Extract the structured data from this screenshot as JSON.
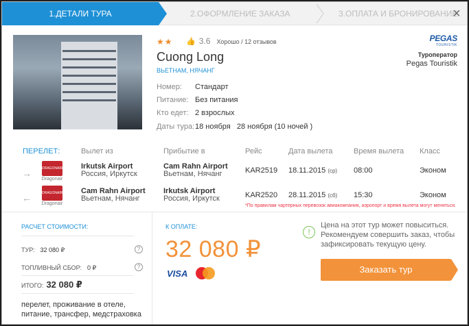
{
  "steps": [
    {
      "label": "1.Детали тура"
    },
    {
      "label": "2.Оформление заказа"
    },
    {
      "label": "3.Оплата и бронирование"
    }
  ],
  "close_glyph": "×",
  "hotel": {
    "stars": "★★",
    "rating_score": "3.6",
    "rating_text": "Хорошо / 12 отзывов",
    "name": "Cuong Long",
    "location": "Вьетнам, Нячанг",
    "details": [
      {
        "label": "Номер:",
        "value": "Стандарт"
      },
      {
        "label": "Питание:",
        "value": "Без питания"
      },
      {
        "label": "Кто едет:",
        "value": "2 взрослых"
      },
      {
        "label": "Даты тура:",
        "value": "18 ноября   28 ноября (10 ночей )"
      }
    ]
  },
  "operator": {
    "logo_text": "PEGAS",
    "logo_sub": "touristik",
    "label": "Туроператор",
    "name": "Pegas Touristik"
  },
  "flights": {
    "headers": [
      "ПЕРЕЛЕТ:",
      "Вылет из",
      "Прибытие в",
      "Рейс",
      "Дата вылета",
      "Время вылета",
      "Класс"
    ],
    "rows": [
      {
        "direction_icon": "→",
        "airline_logo": "DRAGONAIR",
        "airline_name": "Dragonair",
        "from_airport": "Irkutsk Airport",
        "from_place": "Россия, Иркутск",
        "to_airport": "Cam Rahn Airport",
        "to_place": "Вьетнам, Нячанг",
        "flight": "KAR2519",
        "date": "18.11.2015",
        "weekday": "(ср)",
        "time": "08:00",
        "class": "Эконом"
      },
      {
        "direction_icon": "←",
        "airline_logo": "DRAGONAIR",
        "airline_name": "Dragonair",
        "from_airport": "Cam Rahn Airport",
        "from_place": "Вьетнам, Нячанг",
        "to_airport": "Irkutsk Airport",
        "to_place": "Россия, Иркутск",
        "flight": "KAR2520",
        "date": "28.11.2015",
        "weekday": "(сб)",
        "time": "15:30",
        "class": "Эконом"
      }
    ],
    "disclaimer": "*По правилам чартерных перевозок авиакомпания, аэропорт и время вылета могут меняться."
  },
  "calc": {
    "title": "Расчет стоимости:",
    "tour_label": "Тур:",
    "tour_value": "32 080 ₽",
    "fuel_label": "Топливный сбор:",
    "fuel_value": "0 ₽",
    "total_label": "Итого:",
    "total_value": "32 080 ₽",
    "includes": "перелет, проживание в отеле, питание, трансфер, медстраховка",
    "help_glyph": "?"
  },
  "payment": {
    "title": "К оплате:",
    "price": "32 080 ₽",
    "visa": "VISA",
    "mastercard": "MasterCard"
  },
  "notice": {
    "icon": "!",
    "text": "Цена на этот тур может повыситься. Рекомендуем совершить заказ, чтобы зафиксировать текущую цену."
  },
  "order_button": "Заказать тур"
}
